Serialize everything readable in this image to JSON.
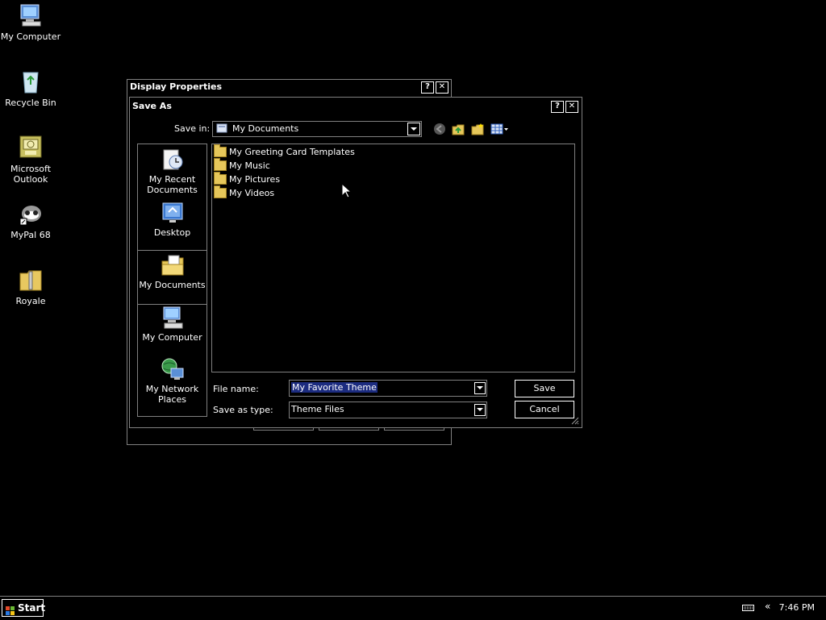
{
  "desktop": {
    "icons": [
      {
        "label": "My Computer"
      },
      {
        "label": "Recycle Bin"
      },
      {
        "label": "Microsoft Outlook"
      },
      {
        "label": "MyPal 68"
      },
      {
        "label": "Royale"
      }
    ]
  },
  "display_properties": {
    "title": "Display Properties"
  },
  "save_as": {
    "title": "Save As",
    "save_in_label": "Save in:",
    "save_in_value": "My Documents",
    "places": [
      {
        "label": "My Recent Documents"
      },
      {
        "label": "Desktop"
      },
      {
        "label": "My Documents"
      },
      {
        "label": "My Computer"
      },
      {
        "label": "My Network Places"
      }
    ],
    "files": [
      {
        "name": "My Greeting Card Templates"
      },
      {
        "name": "My Music"
      },
      {
        "name": "My Pictures"
      },
      {
        "name": "My Videos"
      }
    ],
    "file_name_label": "File name:",
    "file_name_value": "My Favorite Theme",
    "save_type_label": "Save as type:",
    "save_type_value": "Theme Files",
    "save_button": "Save",
    "cancel_button": "Cancel"
  },
  "taskbar": {
    "start_label": "Start",
    "clock": "7:46 PM"
  },
  "colors": {
    "background": "#000000",
    "border": "#808080",
    "selection": "#1c2c80",
    "folder": "#e6c75a"
  }
}
